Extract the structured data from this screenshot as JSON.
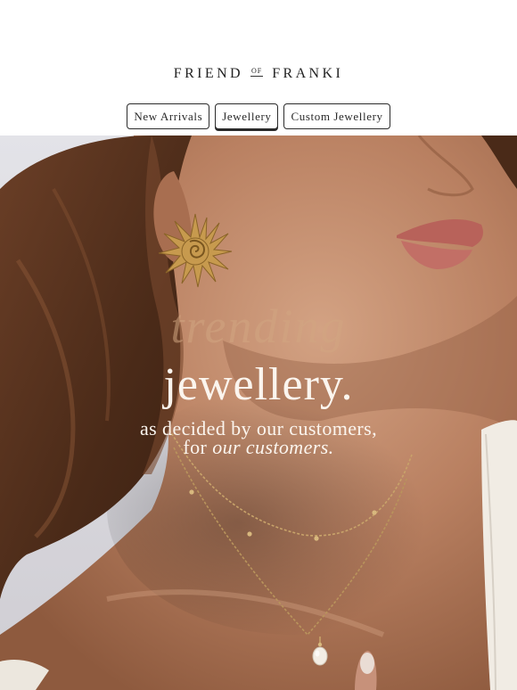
{
  "brand": {
    "logo_left": "FRIEND",
    "logo_of": "OF",
    "logo_right": "FRANKI"
  },
  "nav": {
    "items": [
      {
        "label": "New Arrivals"
      },
      {
        "label": "Jewellery"
      },
      {
        "label": "Custom Jewellery"
      }
    ]
  },
  "hero": {
    "line_trending": "trending",
    "line_jewellery": "jewellery.",
    "line_sub1": "as decided by our customers,",
    "line_sub2_prefix": "for ",
    "line_sub2_em": "our customers."
  },
  "colors": {
    "text_dark": "#2b2b2b",
    "skin": "#b27a5a",
    "hair": "#5a3420",
    "background_wall": "#d9d8de",
    "overlay_text": "#fbf5ee"
  },
  "icons": [
    "sun-earring",
    "pearl-pendant"
  ]
}
